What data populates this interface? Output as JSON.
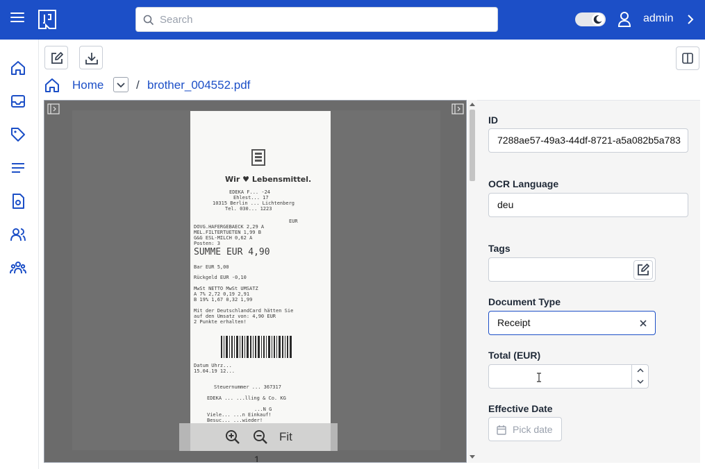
{
  "header": {
    "search_placeholder": "Search",
    "username": "admin"
  },
  "sidebar": {
    "items": [
      {
        "icon": "home-icon"
      },
      {
        "icon": "inbox-icon"
      },
      {
        "icon": "tag-icon"
      },
      {
        "icon": "list-icon"
      },
      {
        "icon": "document-type-icon"
      },
      {
        "icon": "users-icon"
      },
      {
        "icon": "groups-icon"
      }
    ]
  },
  "breadcrumb": {
    "home": "Home",
    "separator": "/",
    "file": "brother_004552.pdf"
  },
  "viewer": {
    "fit_label": "Fit",
    "page_number": "1"
  },
  "receipt": {
    "lines": [
      "Wir ♥ Lebensmittel.",
      "EDEKA F...  -24",
      "Ehlest... 17",
      "10315 Berlin ... Lichtenberg",
      "Tel. 030... 1223",
      "EUR",
      "DOVG.HAFERGEBAECK        2,29 A",
      "MEL.FILTERTUETEN         1,99 B",
      "G&G ESL-MILCH            0,62 A",
      "Posten: 3",
      "SUMME  EUR       4,90",
      "Bar              EUR       5,00",
      "Rückgeld         EUR      -0,10",
      "MwSt    NETTO    MwSt  UMSATZ",
      "A 7%     2,72    0,19    2,91",
      "B 19%    1,67    0,32    1,99",
      "Mit der DeutschlandCard hätten Sie",
      "auf den Umsatz von: 4,90 EUR",
      "2 Punkte erhalten!",
      "Datum Uhrz...",
      "15.04.19 12...",
      "Steuernummer ... 367317",
      "EDEKA ...  ...lling & Co. KG",
      "...N G",
      "Viele...   ...n Einkauf!",
      "Besuc...   ...wieder!"
    ]
  },
  "form": {
    "id_label": "ID",
    "id_value": "7288ae57-49a3-44df-8721-a5a082b5a783",
    "ocr_label": "OCR Language",
    "ocr_value": "deu",
    "tags_label": "Tags",
    "tags_value": "",
    "doctype_label": "Document Type",
    "doctype_value": "Receipt",
    "total_label": "Total (EUR)",
    "total_value": "",
    "date_label": "Effective Date",
    "date_placeholder": "Pick date"
  },
  "colors": {
    "brand": "#1c4fc7",
    "viewer_bg": "#6b6b6b",
    "form_bg": "#f5f5f5"
  }
}
